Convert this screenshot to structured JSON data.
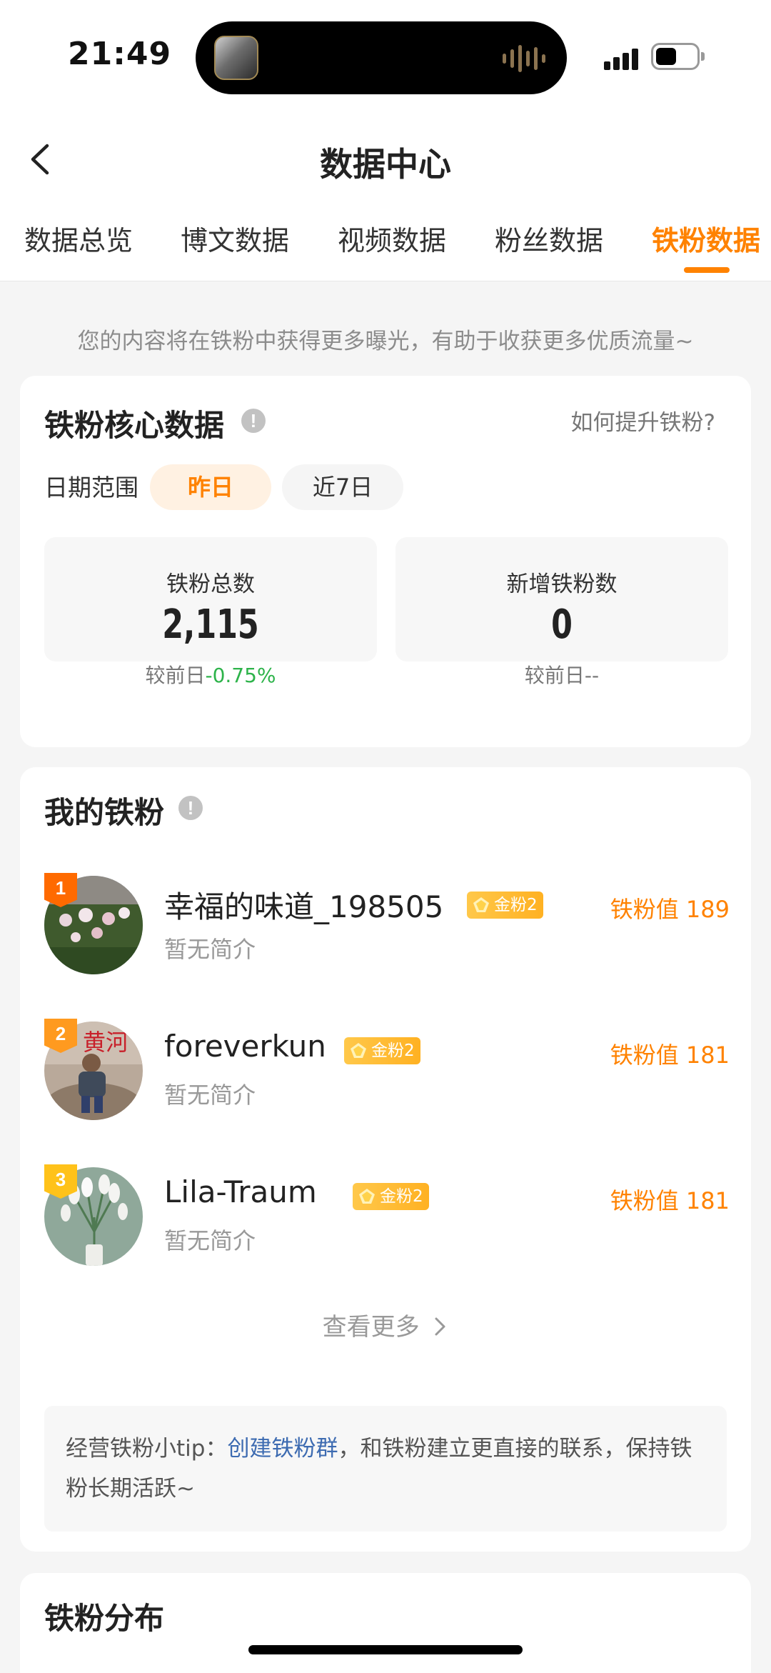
{
  "status_bar": {
    "time": "21:49"
  },
  "nav": {
    "title": "数据中心"
  },
  "tabs": [
    {
      "label": "数据总览",
      "active": false
    },
    {
      "label": "博文数据",
      "active": false
    },
    {
      "label": "视频数据",
      "active": false
    },
    {
      "label": "粉丝数据",
      "active": false
    },
    {
      "label": "铁粉数据",
      "active": true
    }
  ],
  "notice": "您的内容将在铁粉中获得更多曝光，有助于收获更多优质流量~",
  "core": {
    "title": "铁粉核心数据",
    "help_link": "如何提升铁粉?",
    "date_label": "日期范围",
    "date_options": [
      "昨日",
      "近7日"
    ],
    "selected_date": "昨日",
    "stats": [
      {
        "label": "铁粉总数",
        "value": "2,115",
        "compare_prefix": "较前日",
        "compare_value": "-0.75%"
      },
      {
        "label": "新增铁粉数",
        "value": "0",
        "compare_prefix": "较前日",
        "compare_value": "--"
      }
    ]
  },
  "my_fans": {
    "title": "我的铁粉",
    "fans": [
      {
        "rank": "1",
        "name": "幸福的味道_198505",
        "badge": "金粉2",
        "bio": "暂无简介",
        "score_label": "铁粉值 189"
      },
      {
        "rank": "2",
        "name": "foreverkun",
        "badge": "金粉2",
        "bio": "暂无简介",
        "score_label": "铁粉值 181"
      },
      {
        "rank": "3",
        "name": "Lila-Traum",
        "badge": "金粉2",
        "bio": "暂无简介",
        "score_label": "铁粉值 181"
      }
    ],
    "see_more": "查看更多",
    "tip_prefix": "经营铁粉小tip：",
    "tip_link": "创建铁粉群",
    "tip_suffix": "，和铁粉建立更直接的联系，保持铁粉长期活跃~"
  },
  "distribution": {
    "title": "铁粉分布"
  },
  "colors": {
    "accent": "#ff8200",
    "negative_change": "#2db34a",
    "link": "#3d6bb1",
    "rank1": "#ff6a00",
    "rank2": "#ff9a1f",
    "rank3": "#ffc21a"
  }
}
